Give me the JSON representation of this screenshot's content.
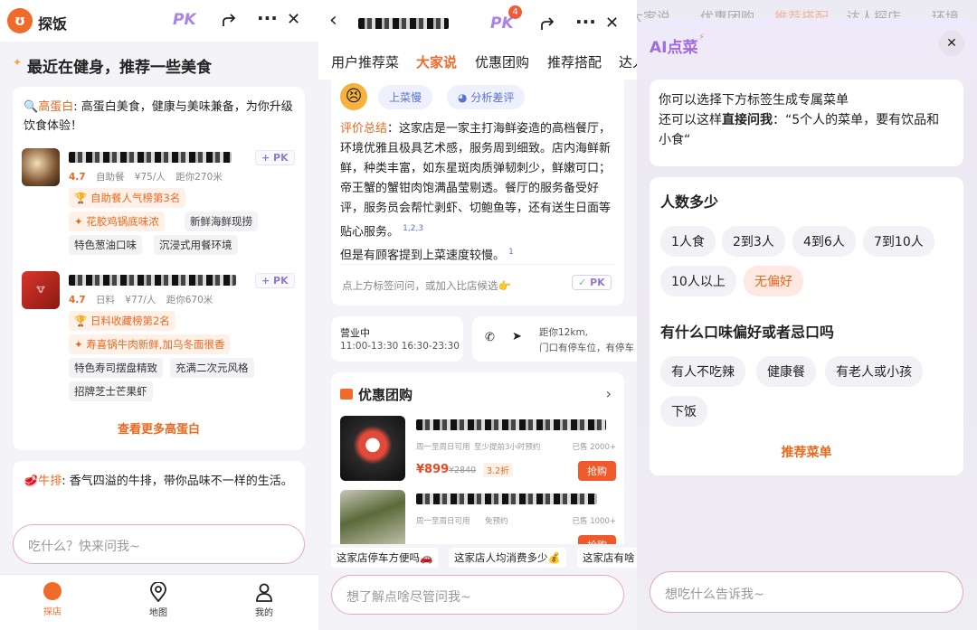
{
  "panel1": {
    "app_name": "探饭",
    "pk_label": "PK",
    "heading": "最近在健身，推荐一些美食",
    "section1": {
      "title": "高蛋白",
      "desc": ": 高蛋白美食，健康与美味兼备，为你升级饮食体验！",
      "restaurants": [
        {
          "rating": "4.7",
          "cuisine": "自助餐",
          "price": "¥75/人",
          "distance": "距你270米",
          "rank_badge": "自助餐人气榜第3名",
          "highlight": "花胶鸡锅底味浓",
          "tags": [
            "新鲜海鲜现捞",
            "特色葱油口味",
            "沉浸式用餐环境"
          ],
          "pk": "+ PK"
        },
        {
          "rating": "4.7",
          "cuisine": "日料",
          "price": "¥77/人",
          "distance": "距你670米",
          "rank_badge": "日料收藏榜第2名",
          "highlight": "寿喜锅牛肉新鲜,加乌冬面很香",
          "tags": [
            "特色寿司摆盘精致",
            "充满二次元风格",
            "招牌芝士芒果虾"
          ],
          "pk": "+ PK"
        }
      ],
      "more": "查看更多高蛋白"
    },
    "section2": {
      "title": "牛排",
      "desc": ": 香气四溢的牛排，带你品味不一样的生活。"
    },
    "input_placeholder": "吃什么？快来问我~",
    "tabs": [
      "探店",
      "地图",
      "我的"
    ]
  },
  "panel2": {
    "pk_label": "PK",
    "pk_badge": "4",
    "tabs": [
      "用户推荐菜",
      "大家说",
      "优惠团购",
      "推荐搭配",
      "达人"
    ],
    "active_tab": "大家说",
    "chip1": "上菜慢",
    "chip2": "分析差评",
    "summary_label": "评价总结",
    "summary_text": "：这家店是一家主打海鲜姿造的高档餐厅，环境优雅且极具艺术感，服务周到细致。店内海鲜新鲜，种类丰富，如东星斑肉质弹韧刺少，鲜嫩可口；帝王蟹的蟹钳肉饱满晶莹剔透。餐厅的服务备受好评，服务员会帮忙剥虾、切鲍鱼等，还有送生日面等贴心服务。",
    "ref1": "1,2,3",
    "summary_text2": "但是有顾客提到上菜速度较慢。",
    "ref2": "1",
    "hint": "点上方标签问问，或加入比店候选👉",
    "hint_pk": "PK",
    "hours_label": "营业中",
    "hours": "11:00-13:30 16:30-23:30",
    "distance": "距你12km,",
    "parking": "门口有停车位，有停车",
    "group_title": "优惠团购",
    "deals": [
      {
        "meta1": "周一至周日可用",
        "meta2": "至少提前3小时预约",
        "sold": "已售 2000+",
        "price": "¥899",
        "orig": "¥2840",
        "discount": "3.2折",
        "button": "抢购"
      },
      {
        "meta1": "周一至周日可用",
        "meta2": "免预约",
        "sold": "已售 1000+",
        "price": "",
        "orig": "",
        "discount": "",
        "button": "抢购"
      }
    ],
    "suggestions": [
      "这家店停车方便吗🚗",
      "这家店人均消费多少💰",
      "这家店有啥"
    ],
    "input_placeholder": "想了解点啥尽管问我~"
  },
  "panel3": {
    "bg_tabs": [
      "大家说",
      "优惠团购",
      "推荐搭配",
      "达人探店",
      "环境"
    ],
    "title": "AI点菜",
    "intro1": "你可以选择下方标签生成专属菜单",
    "intro2_a": "还可以这样",
    "intro2_b": "直接问我",
    "intro2_c": "：“5个人的菜单，要有饮品和小食“",
    "q1": "人数多少",
    "q1_options": [
      "1人食",
      "2到3人",
      "4到6人",
      "7到10人",
      "10人以上",
      "无偏好"
    ],
    "q2": "有什么口味偏好或者忌口吗",
    "q2_options": [
      "有人不吃辣",
      "健康餐",
      "有老人或小孩",
      "下饭"
    ],
    "recommend": "推荐菜单",
    "input_placeholder": "想吃什么告诉我~"
  }
}
